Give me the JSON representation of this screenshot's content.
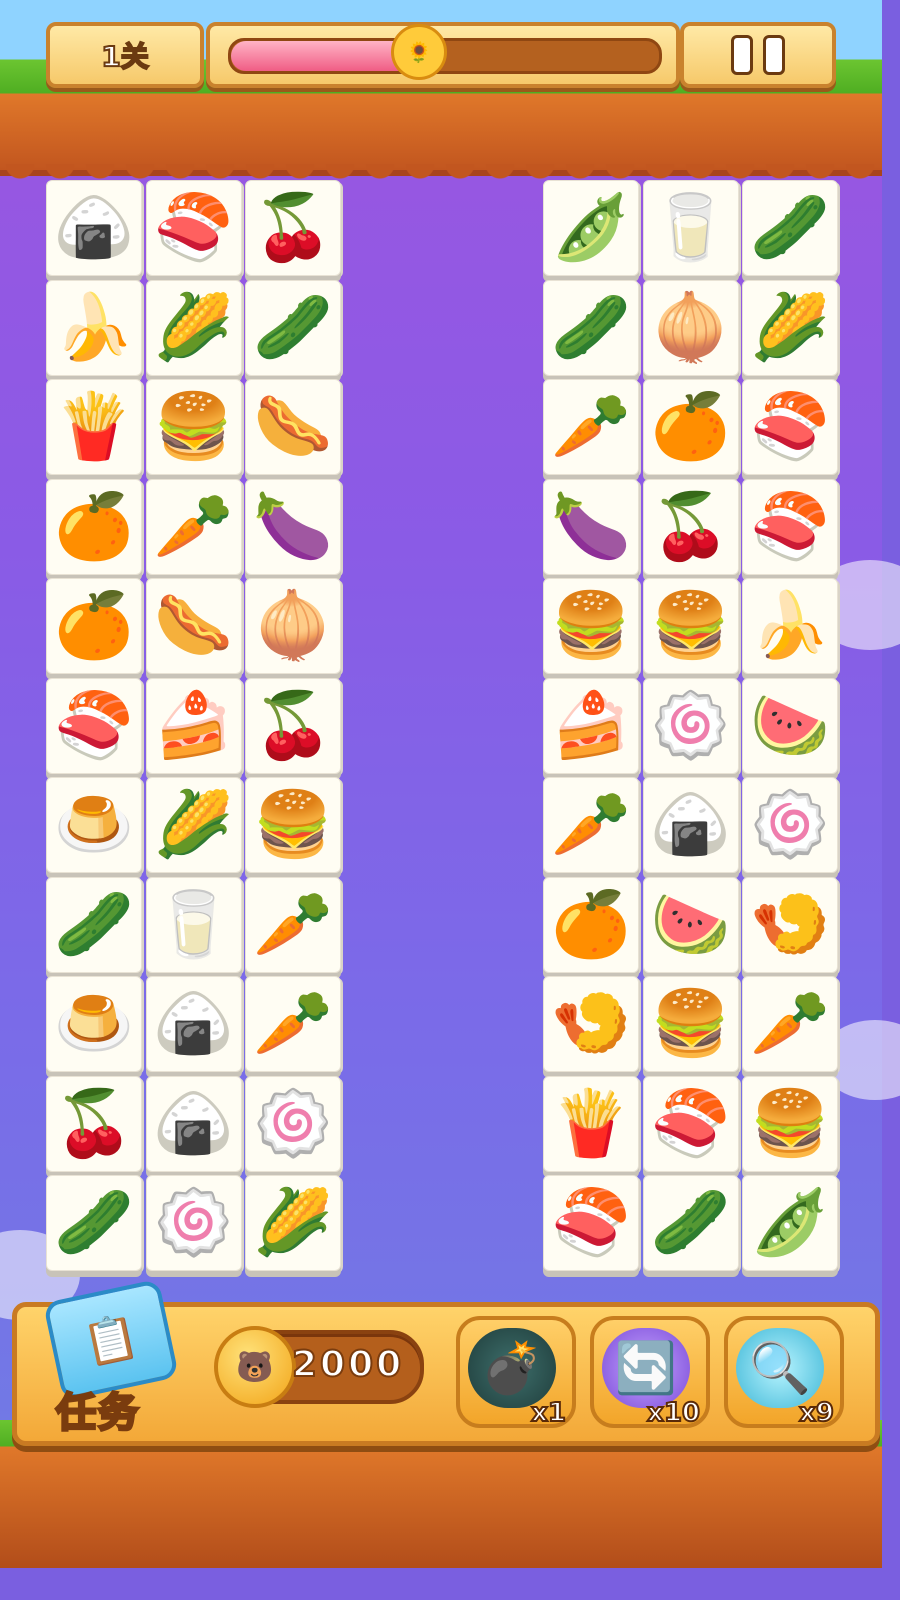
{
  "header": {
    "level_label": "1关",
    "level_progress": 0.44,
    "progress_icon": "sunflower-face-icon",
    "pause_icon": "pause-icon"
  },
  "board": {
    "left_columns": [
      [
        "🍙",
        "🍣",
        "🍒",
        "🍌",
        "🌽",
        "🥒",
        "🍟",
        "🍔",
        "🌭",
        "🍊",
        "🥕",
        "🍆",
        "🍊",
        "🌭",
        "🧅",
        "🍣",
        "🍰",
        "🍒",
        "🍮",
        "🌽",
        "🍔",
        "🥒",
        "🥛",
        "🥕",
        "🍮",
        "🍙",
        "🥕",
        "🍒",
        "🍙",
        "🍥",
        "🥒",
        "🍥",
        "🌽"
      ],
      []
    ],
    "left_grid": [
      [
        "🍙",
        "🍣",
        "🍒"
      ],
      [
        "🍌",
        "🌽",
        "🥒"
      ],
      [
        "🍟",
        "🍔",
        "🌭"
      ],
      [
        "🍊",
        "🥕",
        "🍆"
      ],
      [
        "🍊",
        "🌭",
        "🧅"
      ],
      [
        "🍣",
        "🍰",
        "🍒"
      ],
      [
        "🍮",
        "🌽",
        "🍔"
      ],
      [
        "🥒",
        "🥛",
        "🥕"
      ],
      [
        "🍮",
        "🍙",
        "🥕"
      ],
      [
        "🍒",
        "🍙",
        "🍥"
      ],
      [
        "🥒",
        "🍥",
        "🌽"
      ]
    ],
    "right_grid": [
      [
        "🫛",
        "🥛",
        "🥒"
      ],
      [
        "🥒",
        "🧅",
        "🌽"
      ],
      [
        "🥕",
        "🍊",
        "🍣"
      ],
      [
        "🍆",
        "🍒",
        "🍣"
      ],
      [
        "🍔",
        "🍔",
        "🍌"
      ],
      [
        "🍰",
        "🍥",
        "🍉"
      ],
      [
        "🥕",
        "🍙",
        "🍥"
      ],
      [
        "🍊",
        "🍉",
        "🍤"
      ],
      [
        "🍤",
        "🍔",
        "🥕"
      ],
      [
        "🍟",
        "🍣",
        "🍔"
      ],
      [
        "🍣",
        "🥒",
        "🫛"
      ]
    ]
  },
  "bottom": {
    "task_label": "任务",
    "task_icon": "task-card-icon",
    "coins": "2000",
    "coin_icon": "coin-icon",
    "tools": [
      {
        "name": "bomb",
        "icon": "💣",
        "count": "x1"
      },
      {
        "name": "shuffle",
        "icon": "🔄",
        "count": "x10"
      },
      {
        "name": "magnifier",
        "icon": "🔍",
        "count": "x9"
      }
    ]
  }
}
